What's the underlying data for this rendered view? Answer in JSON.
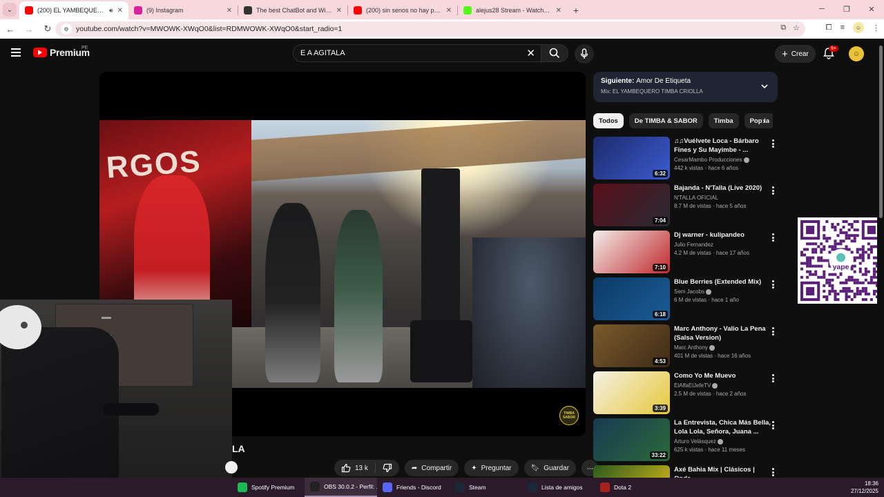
{
  "browser": {
    "tabs": [
      {
        "title": "(200) EL YAMBEQUERO TIM",
        "favicon_color": "#ff0000",
        "active": true
      },
      {
        "title": "(9) Instagram",
        "favicon_color": "#d6249f",
        "active": false
      },
      {
        "title": "The best ChatBot and Widgets",
        "favicon_color": "#333333",
        "active": false
      },
      {
        "title": "(200) sin senos no hay paraiso",
        "favicon_color": "#ff0000",
        "active": false
      },
      {
        "title": "alejus28 Stream - Watch Live on",
        "favicon_color": "#53fc18",
        "active": false
      }
    ],
    "url": "youtube.com/watch?v=MWOWK-XWqO0&list=RDMWOWK-XWqO0&start_radio=1"
  },
  "youtube": {
    "logo_text": "Premium",
    "country_code": "PE",
    "search_value": "E A AGITALA",
    "create_label": "Crear",
    "notification_count": "9+"
  },
  "video": {
    "title_fragment": "LA",
    "likes": "13 k",
    "share_label": "Compartir",
    "ask_label": "Preguntar",
    "save_label": "Guardar",
    "watermark": "TIMBA SABOR"
  },
  "playlist": {
    "next_label": "Siguiente:",
    "next_title": "Amor De Etiqueta",
    "mix_label": "Mix: EL YAMBEQUERO TIMBA CRIOLLA"
  },
  "chips": [
    "Todos",
    "De TIMBA & SABOR",
    "Timba",
    "Pop la"
  ],
  "recommendations": [
    {
      "title": "♫♫Vuélvete Loca - Bárbaro Fines y Su Mayimbe - ...",
      "channel": "CesarMambo Producciones",
      "verified": true,
      "meta": "442 k vistas · hace 6 años",
      "duration": "6:32",
      "thumb": [
        "#1d2b6b",
        "#3b5bd1"
      ]
    },
    {
      "title": "Bajanda - N'Talla (Live 2020)",
      "channel": "N'TALLA OFICIAL",
      "verified": false,
      "meta": "8.7 M de vistas · hace 5 años",
      "duration": "7:04",
      "thumb": [
        "#5a0f18",
        "#2a2a35"
      ]
    },
    {
      "title": "Dj warner - kulipandeo",
      "channel": "Julio Fernandez",
      "verified": false,
      "meta": "4.2 M de vistas · hace 17 años",
      "duration": "7:10",
      "thumb": [
        "#f1eeea",
        "#c2282c"
      ]
    },
    {
      "title": "Blue Berries (Extended Mix)",
      "channel": "Sem Jacobs",
      "verified": true,
      "meta": "6 M de vistas · hace 1 año",
      "duration": "6:18",
      "thumb": [
        "#0c3a66",
        "#1b5c96"
      ]
    },
    {
      "title": "Marc Anthony - Valio La Pena (Salsa Version)",
      "channel": "Marc Anthony",
      "verified": true,
      "meta": "401 M de vistas · hace 16 años",
      "duration": "4:53",
      "thumb": [
        "#7b5a2a",
        "#3d2b18"
      ]
    },
    {
      "title": "Como Yo Me Muevo",
      "channel": "ElAlfaElJefeTV",
      "verified": true,
      "meta": "2.5 M de vistas · hace 2 años",
      "duration": "3:39",
      "thumb": [
        "#f4f0e6",
        "#e7c83a"
      ]
    },
    {
      "title": "La Entrevista, Chica Más Bella, Lola Lola, Señora, Juana ...",
      "channel": "Arturo Velásquez",
      "verified": true,
      "meta": "625 k vistas · hace 11 meses",
      "duration": "33:22",
      "thumb": [
        "#183a52",
        "#2b6a3a"
      ]
    },
    {
      "title": "Axé Bahia Mix | Clásicos | Onda",
      "channel": "",
      "verified": false,
      "meta": "",
      "duration": "",
      "thumb": [
        "#2a5a1c",
        "#e9c21a"
      ]
    }
  ],
  "taskbar": [
    {
      "label": "Spotify Premium",
      "icon_color": "#1db954",
      "active": false
    },
    {
      "label": "OBS 30.0.2 - Perfil: ...",
      "icon_color": "#222222",
      "active": true
    },
    {
      "label": "Friends - Discord",
      "icon_color": "#5865f2",
      "active": false
    },
    {
      "label": "Steam",
      "icon_color": "#1b2838",
      "active": false
    },
    {
      "label": "Lista de amigos",
      "icon_color": "#1b2838",
      "active": false
    },
    {
      "label": "Dota 2",
      "icon_color": "#a4241c",
      "active": false
    }
  ],
  "clock": {
    "time": "18:36",
    "date": "27/12/2025"
  },
  "qr_label": "yape"
}
